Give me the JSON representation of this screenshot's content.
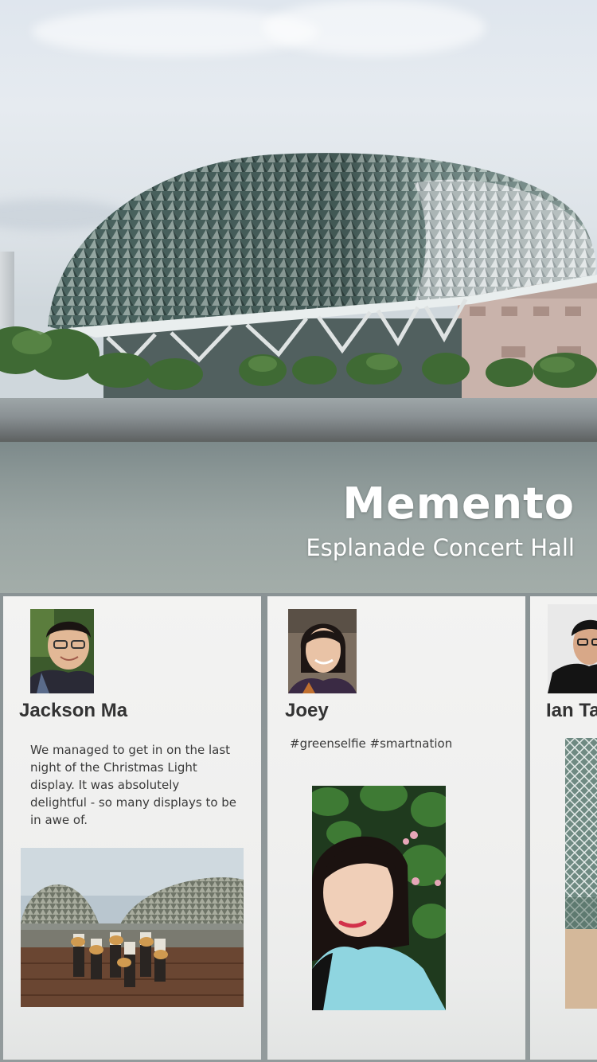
{
  "header": {
    "app_title": "Memento",
    "location": "Esplanade Concert Hall"
  },
  "posts": [
    {
      "author": "Jackson Ma",
      "text": "We managed to get in on the last night of the Christmas Light display. It was absolutely delightful - so many displays to be in awe of.",
      "photo": "group-performance-photo"
    },
    {
      "author": "Joey",
      "text": "#greenselfie #smartnation",
      "photo": "selfie-photo"
    },
    {
      "author": "Ian Ta",
      "text": "",
      "photo": "dome-interior-photo"
    }
  ],
  "colors": {
    "title_text": "#ffffff",
    "card_background": "#f1f1f0",
    "name_text": "#333333",
    "body_text": "#3a3a3a"
  }
}
